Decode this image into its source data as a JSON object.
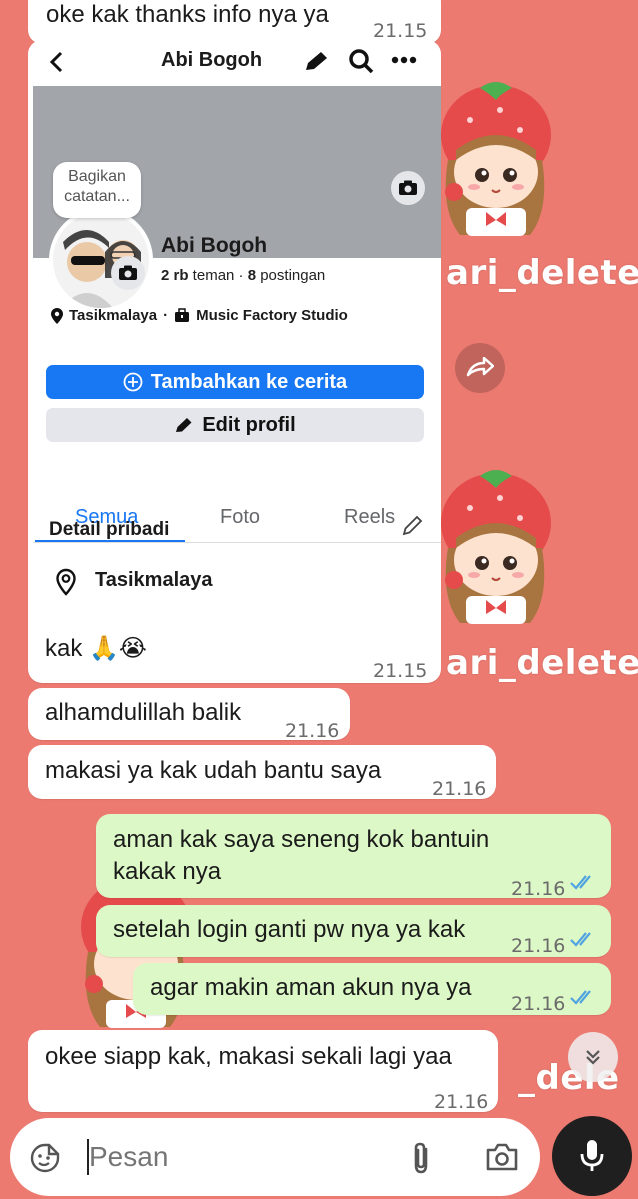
{
  "colors": {
    "wallpaper": "#ec7a70",
    "incoming_bubble": "#ffffff",
    "outgoing_bubble": "#dcf8c6",
    "read_ticks": "#4fa3e0",
    "fb_blue": "#1877f2"
  },
  "wallpaper": {
    "watermark_1": "ari_delete",
    "watermark_2": "ari_delete",
    "watermark_3": "_dele"
  },
  "messages": [
    {
      "id": "m0",
      "dir": "in",
      "text": "oke kak thanks info nya ya",
      "time": "21.15"
    },
    {
      "id": "m1",
      "dir": "in",
      "text": "kak 🙏😭",
      "time": "21.15",
      "has_image": true
    },
    {
      "id": "m2",
      "dir": "in",
      "text": "alhamdulillah balik",
      "time": "21.16"
    },
    {
      "id": "m3",
      "dir": "in",
      "text": "makasi ya kak udah bantu saya",
      "time": "21.16"
    },
    {
      "id": "m4",
      "dir": "out",
      "line1": "aman kak saya seneng kok bantuin",
      "line2": "kakak nya",
      "time": "21.16",
      "status": "read"
    },
    {
      "id": "m5",
      "dir": "out",
      "text": "setelah login ganti pw nya ya kak",
      "time": "21.16",
      "status": "read"
    },
    {
      "id": "m6",
      "dir": "out",
      "text": "agar makin aman akun nya ya",
      "time": "21.16",
      "status": "read"
    },
    {
      "id": "m7",
      "dir": "in",
      "text": "okee siapp kak, makasi sekali lagi yaa",
      "time": "21.16"
    }
  ],
  "fb": {
    "profile_name": "Abi Bogoh",
    "note_line1": "Bagikan",
    "note_line2": "catatan...",
    "stats_friends_count": "2 rb",
    "stats_friends_label": " teman · ",
    "stats_posts_count": "8",
    "stats_posts_label": " postingan",
    "location": "Tasikmalaya",
    "separator": "·",
    "workplace": "Music Factory Studio",
    "add_story_label": "Tambahkan ke cerita",
    "edit_profile_label": "Edit profil",
    "tabs": [
      "Semua",
      "Foto",
      "Reels"
    ],
    "active_tab": "Semua",
    "details_title": "Detail pribadi",
    "details_location": "Tasikmalaya"
  },
  "composer": {
    "placeholder": "Pesan"
  }
}
